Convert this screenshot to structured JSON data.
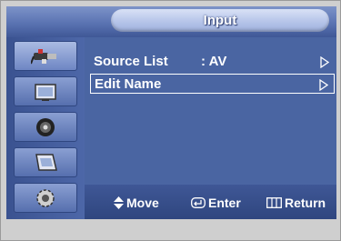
{
  "osd": {
    "title": "Input",
    "menu_items": [
      {
        "label": "Source List",
        "value": ": AV",
        "selected": false
      },
      {
        "label": "Edit Name",
        "value": "",
        "selected": true
      }
    ],
    "side_icons": [
      "input-plug-icon",
      "picture-icon",
      "sound-icon",
      "channel-icon",
      "setup-gear-icon"
    ],
    "hints": {
      "move": "Move",
      "enter": "Enter",
      "return": "Return"
    },
    "colors": {
      "panel": "#4a65a2",
      "title_pill": "#b9c7ea",
      "text": "#ffffff"
    }
  }
}
